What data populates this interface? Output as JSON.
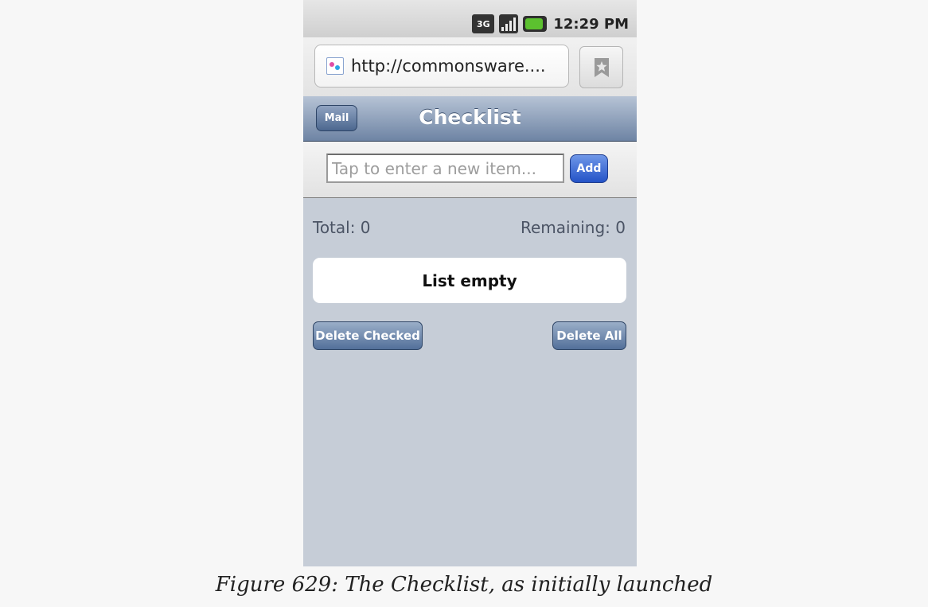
{
  "status_bar": {
    "network_label": "3G",
    "time": "12:29 PM"
  },
  "browser": {
    "url": "http://commonsware...."
  },
  "header": {
    "mail_label": "Mail",
    "title": "Checklist"
  },
  "add_item": {
    "placeholder": "Tap to enter a new item...",
    "add_label": "Add"
  },
  "counts": {
    "total": "Total: 0",
    "remaining": "Remaining: 0"
  },
  "list": {
    "empty_label": "List empty"
  },
  "actions": {
    "delete_checked_label": "Delete Checked",
    "delete_all_label": "Delete All"
  },
  "caption": "Figure 629: The Checklist, as initially launched",
  "colors": {
    "page_background": "#c6cdd7",
    "header_gradient_top": "#b6c3d5",
    "header_gradient_bottom": "#6e84a4",
    "add_button": "#2453c7"
  }
}
